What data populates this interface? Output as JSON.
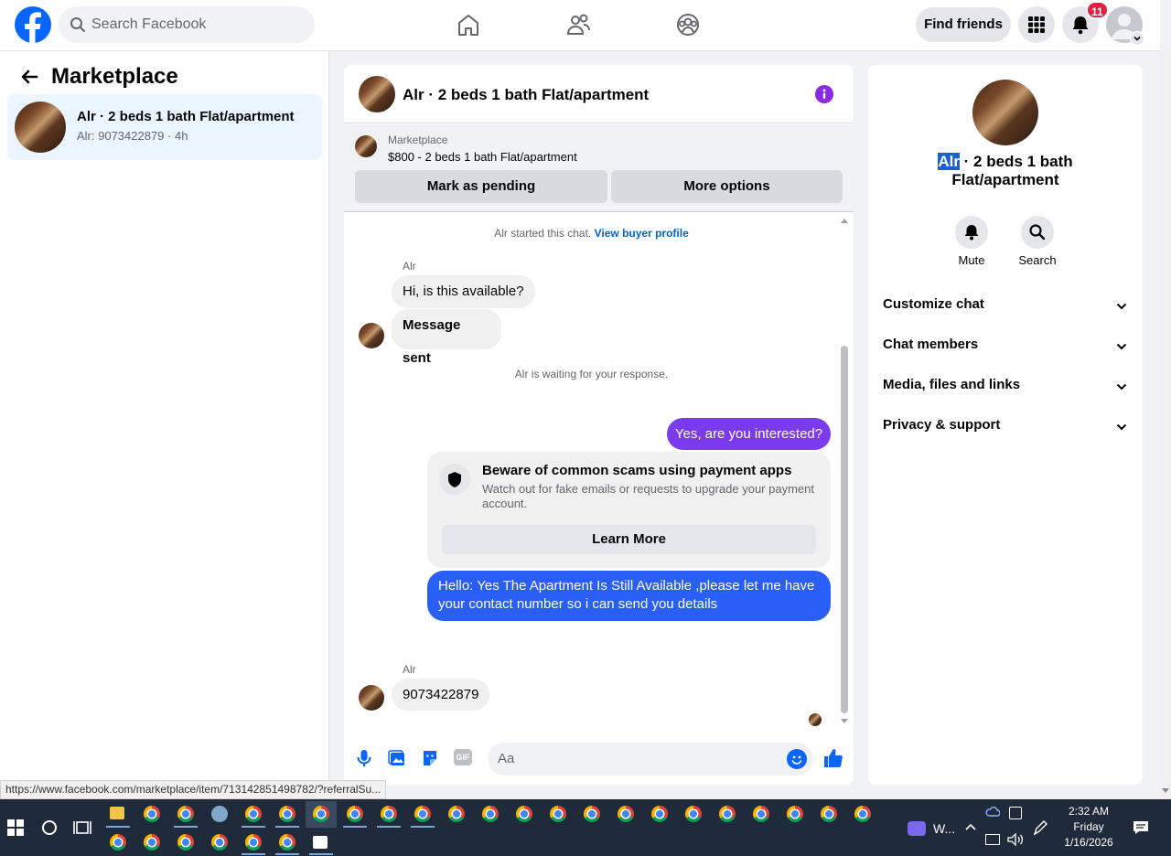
{
  "topbar": {
    "search_placeholder": "Search Facebook",
    "find_friends_label": "Find friends",
    "notification_count": "11"
  },
  "left": {
    "title": "Marketplace",
    "conversation": {
      "title": "Alr · 2 beds 1 bath Flat/apartment",
      "subtitle": "Alr: 9073422879 · 4h"
    }
  },
  "chat": {
    "header_title": "Alr · 2 beds 1 bath Flat/apartment",
    "listing": {
      "label": "Marketplace",
      "price_title": "$800 - 2 beds 1 bath Flat/apartment",
      "mark_pending_label": "Mark as pending",
      "more_options_label": "More options"
    },
    "started_text": "Alr started this chat.",
    "view_buyer_profile": "View buyer profile",
    "sender_name_1": "Alr",
    "msg_1": "Hi, is this available?",
    "msg_2": "Message sent",
    "waiting_text": "Alr is waiting for your response.",
    "out_msg_1": "Yes, are you interested?",
    "scam_card": {
      "title": "Beware of common scams using payment apps",
      "body": "Watch out for fake emails or requests to upgrade your payment account.",
      "button_label": "Learn More"
    },
    "out_msg_2": "Hello: Yes The Apartment Is Still Available ,please let me have your contact number so i can send you details",
    "sender_name_2": "Alr",
    "msg_3": "9073422879",
    "composer_placeholder": "Aa"
  },
  "right": {
    "title_highlight": "Alr",
    "title_rest": " · 2 beds 1 bath Flat/apartment",
    "mute_label": "Mute",
    "search_label": "Search",
    "sections": [
      "Customize chat",
      "Chat members",
      "Media, files and links",
      "Privacy & support"
    ]
  },
  "status_url": "https://www.facebook.com/marketplace/item/713142851498782/?referralSu...",
  "taskbar": {
    "app_label": "W...",
    "time": "2:32 AM",
    "day": "Friday",
    "date": "1/16/2026"
  },
  "colors": {
    "brand_blue": "#0866ff",
    "outgoing_purple": "#7c3aed",
    "outgoing_blue": "#2a5ff7",
    "link_blue": "#0064d1",
    "badge_red": "#e41e3f",
    "taskbar_bg": "#1f2b3a"
  }
}
